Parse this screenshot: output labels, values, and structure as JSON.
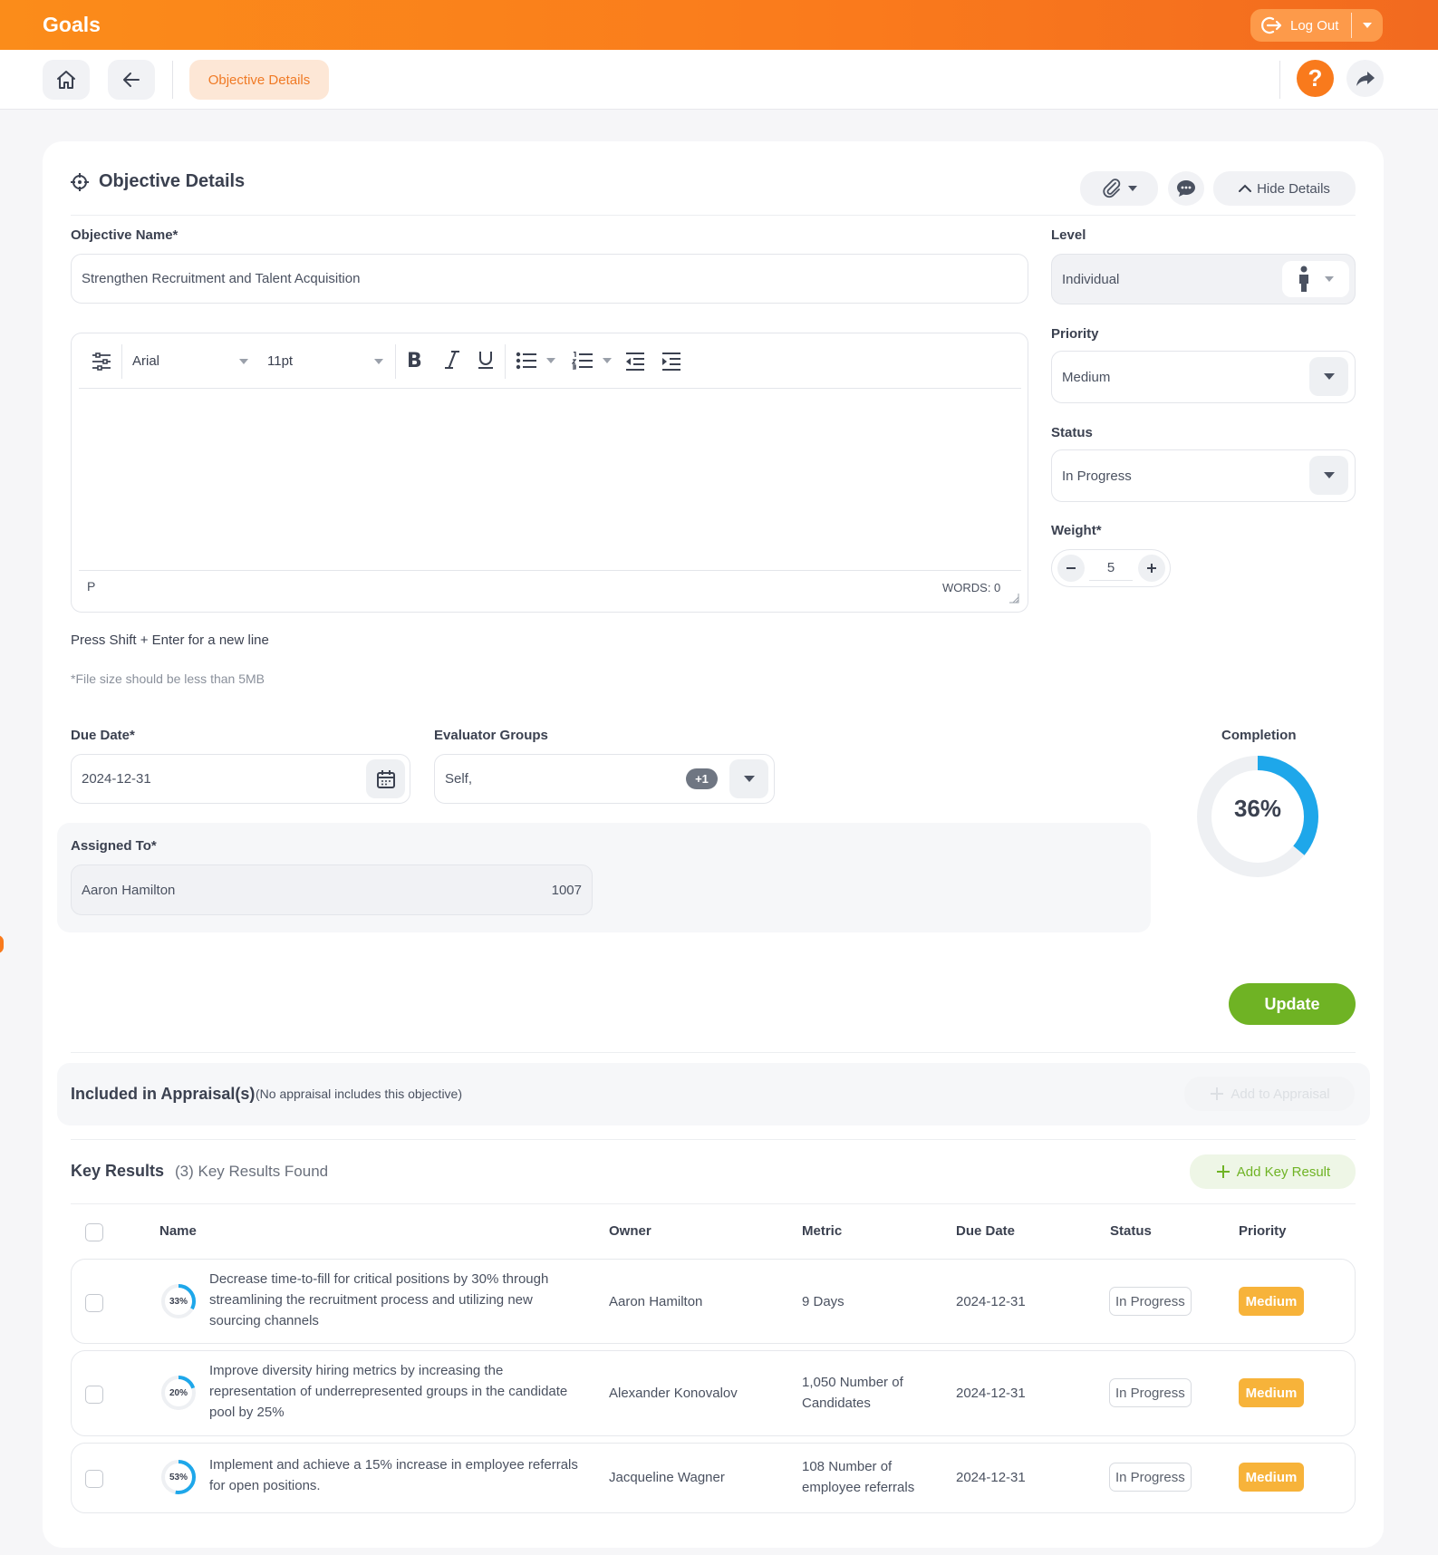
{
  "app": {
    "title": "Goals",
    "logout_label": "Log Out"
  },
  "nav": {
    "breadcrumb": "Objective Details",
    "help_label": "?"
  },
  "section": {
    "title": "Objective Details",
    "hide_details_label": "Hide Details"
  },
  "form": {
    "objective_name_label": "Objective Name*",
    "objective_name_value": "Strengthen Recruitment and Talent Acquisition",
    "level_label": "Level",
    "level_value": "Individual",
    "priority_label": "Priority",
    "priority_value": "Medium",
    "status_label": "Status",
    "status_value": "In Progress",
    "weight_label": "Weight*",
    "weight_value": "5",
    "editor": {
      "font": "Arial",
      "size": "11pt",
      "path": "P",
      "word_count": "WORDS: 0"
    },
    "hint_newline": "Press Shift + Enter for a new line",
    "hint_filesize": "*File size should be less than 5MB",
    "due_date_label": "Due Date*",
    "due_date_value": "2024-12-31",
    "evaluator_label": "Evaluator Groups",
    "evaluator_value": "Self,",
    "evaluator_more": "+1",
    "assigned_label": "Assigned To*",
    "assigned_name": "Aaron Hamilton",
    "assigned_id": "1007",
    "completion_label": "Completion",
    "completion_text": "36%",
    "completion_value": 36,
    "update_label": "Update"
  },
  "appraisal": {
    "title": "Included in Appraisal(s)",
    "note": "(No appraisal includes this objective)",
    "add_label": "Add to Appraisal"
  },
  "key_results": {
    "title": "Key Results",
    "count_text": "(3) Key Results Found",
    "add_label": "Add Key Result",
    "columns": [
      "Name",
      "Owner",
      "Metric",
      "Due Date",
      "Status",
      "Priority"
    ],
    "rows": [
      {
        "progress": 33,
        "progress_text": "33%",
        "name": "Decrease time-to-fill for critical positions by 30% through streamlining the recruitment process and utilizing new sourcing channels",
        "owner": "Aaron Hamilton",
        "metric": "9 Days",
        "due": "2024-12-31",
        "status": "In Progress",
        "priority": "Medium"
      },
      {
        "progress": 20,
        "progress_text": "20%",
        "name": "Improve diversity hiring metrics by increasing the representation of underrepresented groups in the candidate pool by 25%",
        "owner": "Alexander Konovalov",
        "metric": "1,050 Number of Candidates",
        "due": "2024-12-31",
        "status": "In Progress",
        "priority": "Medium"
      },
      {
        "progress": 53,
        "progress_text": "53%",
        "name": "Implement and achieve a 15% increase in employee referrals for open positions.",
        "owner": "Jacqueline Wagner",
        "metric": "108 Number of employee referrals",
        "due": "2024-12-31",
        "status": "In Progress",
        "priority": "Medium"
      }
    ]
  },
  "colors": {
    "accent": "#f97a1c",
    "ring": "#1ea7ea",
    "update": "#6fb324",
    "priority": "#f7b33a"
  }
}
